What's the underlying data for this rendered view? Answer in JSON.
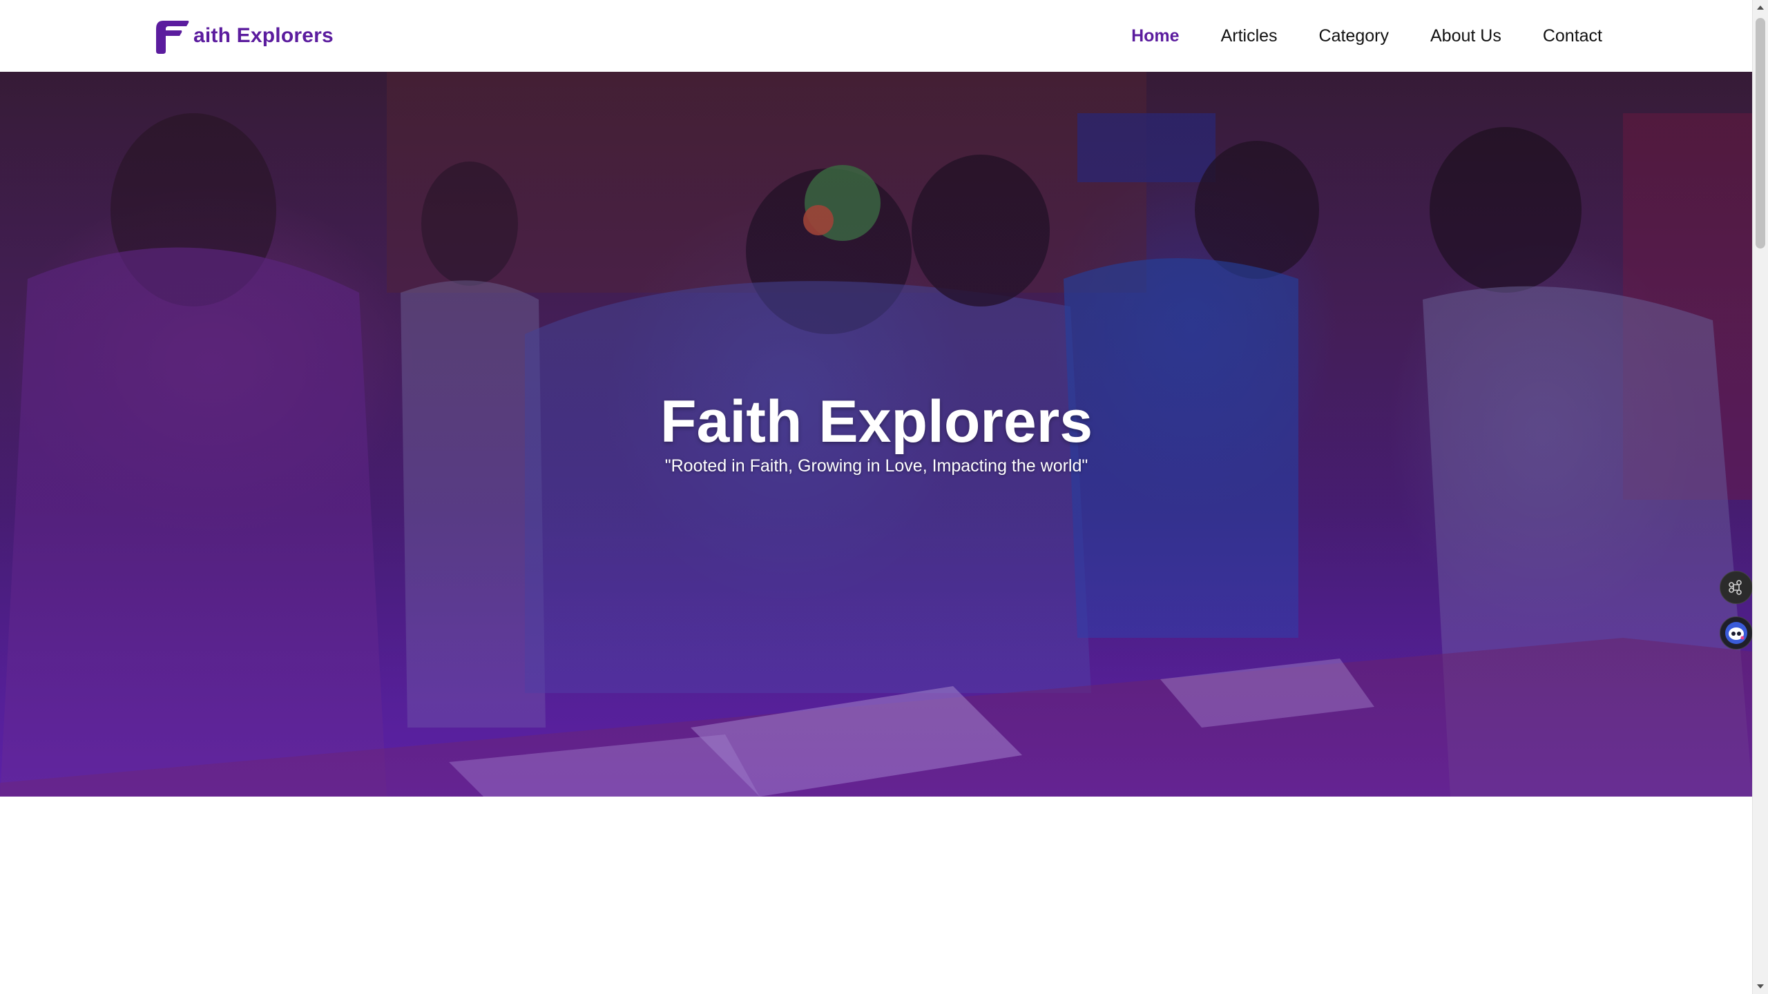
{
  "brand": {
    "name": "aith Explorers",
    "logo_icon": "faith-f-logo",
    "accent": "#5b1c9e"
  },
  "nav": {
    "items": [
      {
        "label": "Home",
        "active": true
      },
      {
        "label": "Articles",
        "active": false
      },
      {
        "label": "Category",
        "active": false
      },
      {
        "label": "About Us",
        "active": false
      },
      {
        "label": "Contact",
        "active": false
      }
    ]
  },
  "hero": {
    "title": "Faith Explorers",
    "tagline": "\"Rooted in Faith, Growing in Love, Impacting the world\"",
    "overlay_color": "#5a1fa0"
  },
  "widgets": {
    "grid_icon": "command-icon",
    "assistant_icon": "assistant-bot-icon"
  }
}
